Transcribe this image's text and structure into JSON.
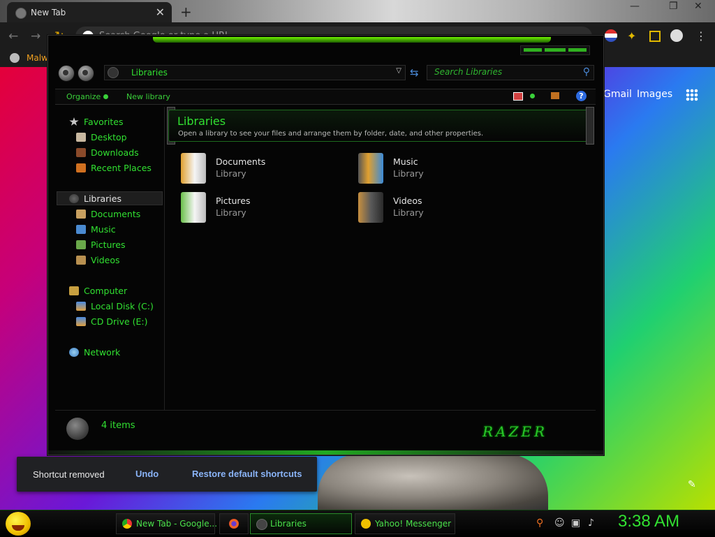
{
  "browser": {
    "tab_title": "New Tab",
    "tab_close": "✕",
    "new_tab": "+",
    "window_controls": [
      "—",
      "❐",
      "✕"
    ],
    "omnibox_placeholder": "Search Google or type a URL",
    "bookmark": "Malwa",
    "google_links": [
      "Gmail",
      "Images"
    ],
    "toast": {
      "message": "Shortcut removed",
      "undo": "Undo",
      "restore": "Restore default shortcuts"
    }
  },
  "explorer": {
    "address": "Libraries",
    "search_placeholder": "Search Libraries",
    "commands": {
      "organize": "Organize",
      "new_library": "New library"
    },
    "help": "?",
    "nav": {
      "favorites": "Favorites",
      "desktop": "Desktop",
      "downloads": "Downloads",
      "recent": "Recent Places",
      "libraries": "Libraries",
      "documents": "Documents",
      "music": "Music",
      "pictures": "Pictures",
      "videos": "Videos",
      "computer": "Computer",
      "local_disk": "Local Disk (C:)",
      "cd_drive": "CD Drive (E:)",
      "network": "Network"
    },
    "header": {
      "title": "Libraries",
      "subtitle": "Open a library to see your files and arrange them by folder, date, and other properties."
    },
    "libraries": [
      {
        "name": "Documents",
        "kind": "Library"
      },
      {
        "name": "Music",
        "kind": "Library"
      },
      {
        "name": "Pictures",
        "kind": "Library"
      },
      {
        "name": "Videos",
        "kind": "Library"
      }
    ],
    "details": {
      "count": "4 items",
      "logo": "RAZER"
    }
  },
  "taskbar": {
    "buttons": [
      {
        "label": "New Tab - Google...",
        "active": false
      },
      {
        "label": "",
        "active": false
      },
      {
        "label": "Libraries",
        "active": true
      },
      {
        "label": "Yahoo! Messenger",
        "active": false
      }
    ],
    "clock": "3:38 AM"
  },
  "colors": {
    "accent": "#31e031",
    "link": "#8ab4f8",
    "window_bg": "#050505"
  }
}
